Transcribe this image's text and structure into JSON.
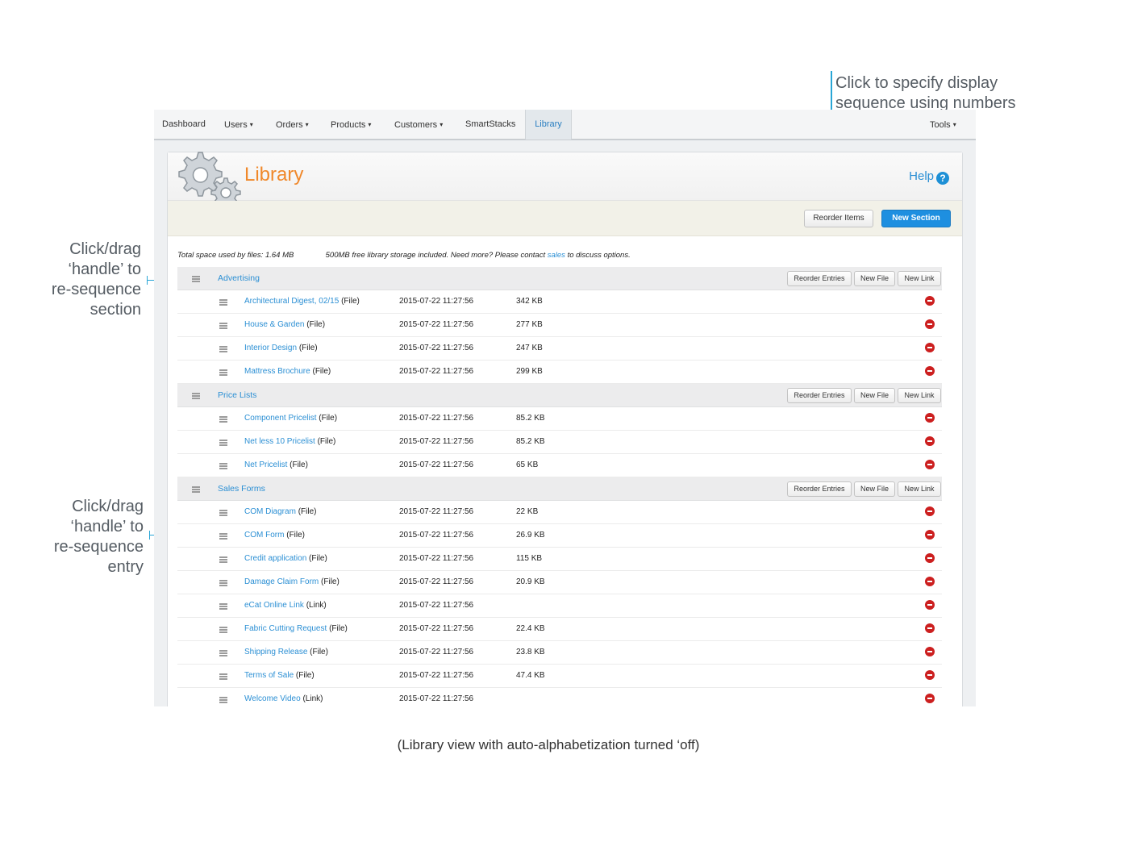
{
  "nav": {
    "items": [
      {
        "label": "Dashboard",
        "caret": ""
      },
      {
        "label": "Users",
        "caret": "▾"
      },
      {
        "label": "Orders",
        "caret": "▾"
      },
      {
        "label": "Products",
        "caret": "▾"
      },
      {
        "label": "Customers",
        "caret": "▾"
      },
      {
        "label": "SmartStacks",
        "caret": ""
      },
      {
        "label": "Library",
        "caret": "",
        "active": true
      }
    ],
    "tools": {
      "label": "Tools",
      "caret": "▾"
    }
  },
  "page": {
    "title": "Library",
    "help_label": "Help",
    "help_icon": "?",
    "reorder_items_label": "Reorder Items",
    "new_section_label": "New Section"
  },
  "storage": {
    "total_text": "Total space used by files: 1.64 MB",
    "note_prefix": "500MB free library storage included. Need more? Please contact",
    "note_link": "sales",
    "note_suffix": "to discuss options."
  },
  "section_buttons": {
    "reorder": "Reorder Entries",
    "new_file": "New File",
    "new_link": "New Link"
  },
  "sections": [
    {
      "name": "Advertising",
      "entries": [
        {
          "name": "Architectural Digest, 02/15",
          "type": "(File)",
          "date": "2015-07-22 11:27:56",
          "size": "342 KB"
        },
        {
          "name": "House & Garden",
          "type": "(File)",
          "date": "2015-07-22 11:27:56",
          "size": "277 KB"
        },
        {
          "name": "Interior Design",
          "type": "(File)",
          "date": "2015-07-22 11:27:56",
          "size": "247 KB"
        },
        {
          "name": "Mattress Brochure",
          "type": "(File)",
          "date": "2015-07-22 11:27:56",
          "size": "299 KB"
        }
      ]
    },
    {
      "name": "Price Lists",
      "entries": [
        {
          "name": "Component Pricelist",
          "type": "(File)",
          "date": "2015-07-22 11:27:56",
          "size": "85.2 KB"
        },
        {
          "name": "Net less 10 Pricelist",
          "type": "(File)",
          "date": "2015-07-22 11:27:56",
          "size": "85.2 KB"
        },
        {
          "name": "Net Pricelist",
          "type": "(File)",
          "date": "2015-07-22 11:27:56",
          "size": "65 KB"
        }
      ]
    },
    {
      "name": "Sales Forms",
      "entries": [
        {
          "name": "COM Diagram",
          "type": "(File)",
          "date": "2015-07-22 11:27:56",
          "size": "22 KB"
        },
        {
          "name": "COM Form",
          "type": "(File)",
          "date": "2015-07-22 11:27:56",
          "size": "26.9 KB"
        },
        {
          "name": "Credit application",
          "type": "(File)",
          "date": "2015-07-22 11:27:56",
          "size": "115 KB"
        },
        {
          "name": "Damage Claim Form",
          "type": "(File)",
          "date": "2015-07-22 11:27:56",
          "size": "20.9 KB"
        },
        {
          "name": "eCat Online Link",
          "type": "(Link)",
          "date": "2015-07-22 11:27:56",
          "size": ""
        },
        {
          "name": "Fabric Cutting Request",
          "type": "(File)",
          "date": "2015-07-22 11:27:56",
          "size": "22.4 KB"
        },
        {
          "name": "Shipping Release",
          "type": "(File)",
          "date": "2015-07-22 11:27:56",
          "size": "23.8 KB"
        },
        {
          "name": "Terms of Sale",
          "type": "(File)",
          "date": "2015-07-22 11:27:56",
          "size": "47.4 KB"
        },
        {
          "name": "Welcome Video",
          "type": "(Link)",
          "date": "2015-07-22 11:27:56",
          "size": ""
        }
      ]
    }
  ],
  "annotations": {
    "top_right": [
      "Click to specify display",
      "sequence using numbers"
    ],
    "section_handle": [
      "Click/drag",
      "‘handle’ to",
      "re-sequence",
      "section"
    ],
    "entry_handle": [
      "Click/drag",
      "‘handle’ to",
      "re-sequence",
      "entry"
    ],
    "caption": "(Library view with auto-alphabetization turned ‘off)"
  },
  "colors": {
    "accent_blue": "#2b8fd4",
    "title_orange": "#f0882a",
    "primary_button": "#1e8fe0",
    "delete_red": "#cc1f1f",
    "annotation_line": "#29a6d6"
  },
  "icons": {
    "logo": "gears-icon",
    "help": "question-circle-icon",
    "drag_handle": "drag-handle-icon",
    "delete": "delete-circle-icon"
  }
}
